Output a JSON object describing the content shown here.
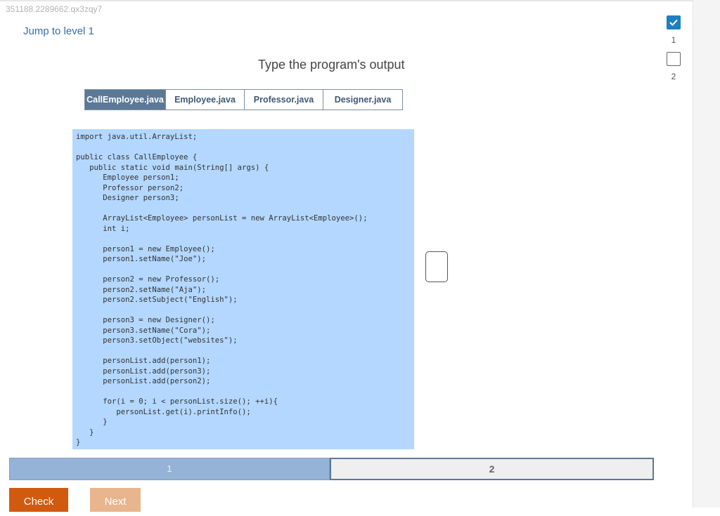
{
  "activity": {
    "id_text": "351188.2289662.qx3zqy7"
  },
  "jump": {
    "label": "Jump to level 1"
  },
  "prompt": {
    "title": "Type the program's output"
  },
  "tabs": [
    {
      "label": "CallEmployee.java",
      "active": true
    },
    {
      "label": "Employee.java",
      "active": false
    },
    {
      "label": "Professor.java",
      "active": false
    },
    {
      "label": "Designer.java",
      "active": false
    }
  ],
  "code": {
    "text": "import java.util.ArrayList;\n\npublic class CallEmployee {\n   public static void main(String[] args) {\n      Employee person1;\n      Professor person2;\n      Designer person3;\n\n      ArrayList<Employee> personList = new ArrayList<Employee>();\n      int i;\n\n      person1 = new Employee();\n      person1.setName(\"Joe\");\n\n      person2 = new Professor();\n      person2.setName(\"Aja\");\n      person2.setSubject(\"English\");\n\n      person3 = new Designer();\n      person3.setName(\"Cora\");\n      person3.setObject(\"websites\");\n\n      personList.add(person1);\n      personList.add(person3);\n      personList.add(person2);\n\n      for(i = 0; i < personList.size(); ++i){\n         personList.get(i).printInfo();\n      }\n   }\n}"
  },
  "answer": {
    "value": ""
  },
  "levels": [
    {
      "number": "1",
      "completed": true
    },
    {
      "number": "2",
      "completed": false
    }
  ],
  "progress": [
    {
      "label": "1",
      "state": "done"
    },
    {
      "label": "2",
      "state": "current"
    }
  ],
  "buttons": {
    "check": "Check",
    "next": "Next"
  },
  "colors": {
    "accent": "#5b7896",
    "code_bg": "#b3d7fe",
    "check_button": "#d25a0f",
    "next_button": "#e9b58e",
    "level_done": "#1c7fc1"
  }
}
